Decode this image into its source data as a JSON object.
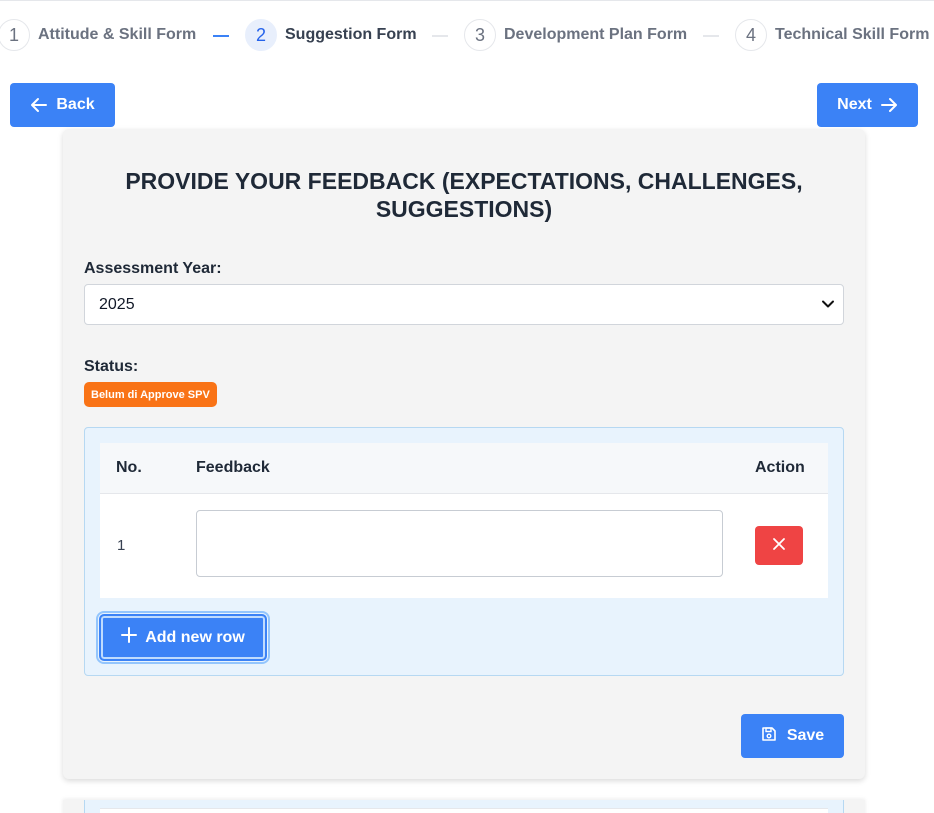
{
  "stepper": {
    "steps": [
      {
        "num": "1",
        "label": "Attitude & Skill Form"
      },
      {
        "num": "2",
        "label": "Suggestion Form"
      },
      {
        "num": "3",
        "label": "Development Plan Form"
      },
      {
        "num": "4",
        "label": "Technical Skill Form"
      }
    ],
    "active_index": 1
  },
  "nav": {
    "back_label": "Back",
    "next_label": "Next"
  },
  "form": {
    "title": "PROVIDE YOUR FEEDBACK (EXPECTATIONS, CHALLENGES, SUGGESTIONS)",
    "year_label": "Assessment Year:",
    "year_value": "2025",
    "status_label": "Status:",
    "status_badge": "Belum di Approve SPV",
    "table": {
      "headers": {
        "no": "No.",
        "feedback": "Feedback",
        "action": "Action"
      },
      "rows": [
        {
          "no": "1",
          "feedback": ""
        }
      ]
    },
    "add_row_label": "Add new row",
    "save_label": "Save"
  },
  "colors": {
    "primary": "#3b82f6",
    "danger": "#ef4444",
    "badge": "#f97316",
    "panel_bg": "#e8f3fd"
  },
  "icons": {
    "back": "arrow-left-icon",
    "next": "arrow-right-icon",
    "select": "chevron-down-icon",
    "delete": "close-icon",
    "add": "plus-icon",
    "save": "save-icon"
  }
}
